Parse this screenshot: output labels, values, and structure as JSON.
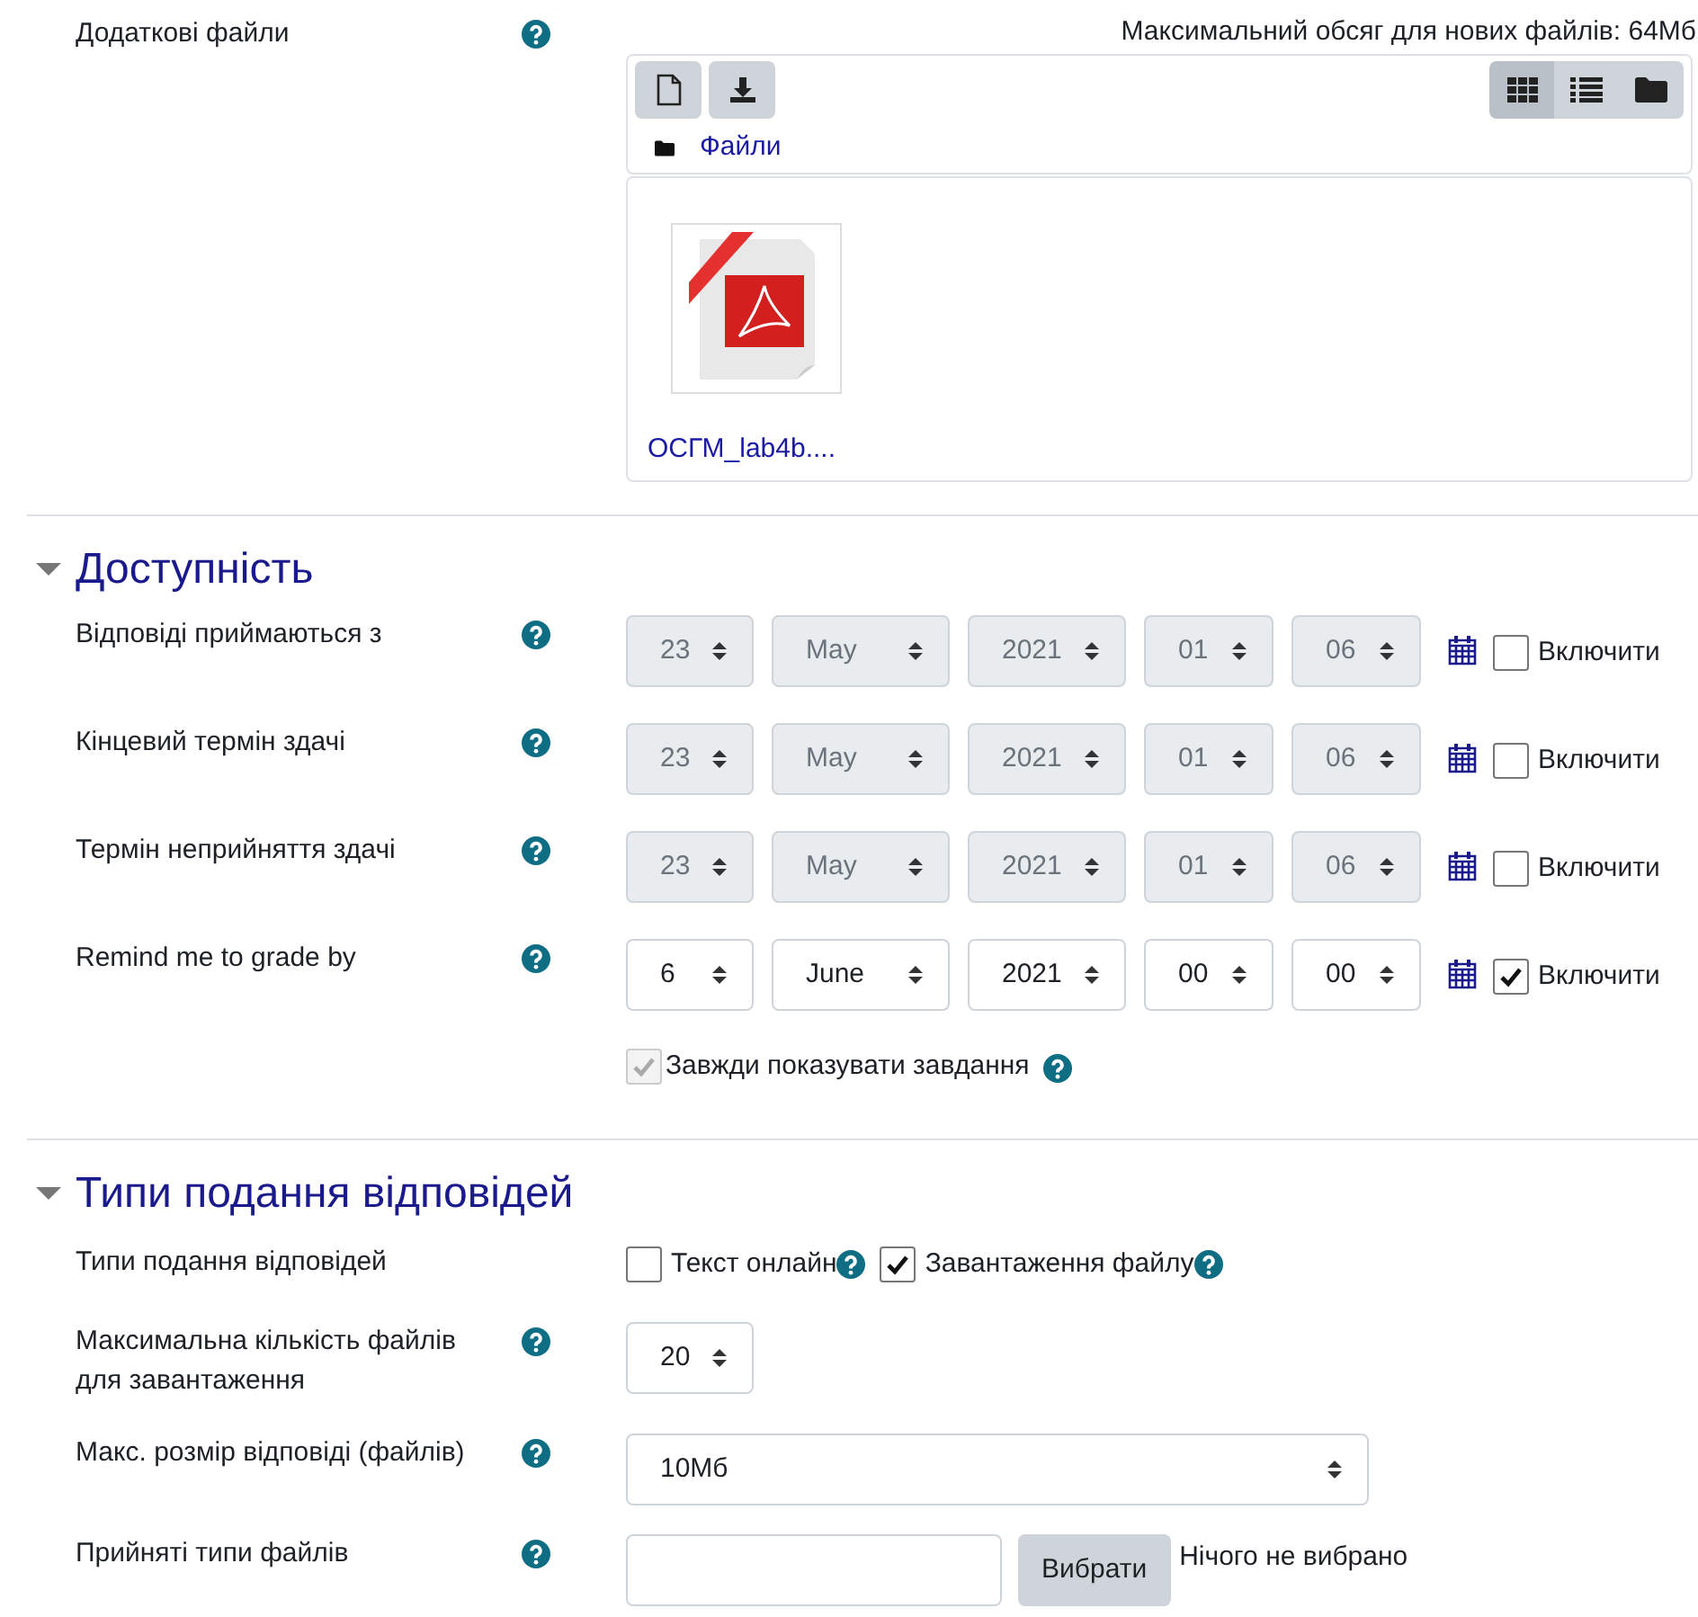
{
  "files_field": {
    "label": "Додаткові файли",
    "max_size": "Максимальний обсяг для нових файлів: 64Мб",
    "breadcrumb": "Файли",
    "view_modes": [
      {
        "kind": "icons",
        "selected": true
      },
      {
        "kind": "list",
        "selected": false
      },
      {
        "kind": "tree",
        "selected": false
      }
    ],
    "files": [
      {
        "name": "ОСГМ_lab4b...."
      }
    ]
  },
  "sections": [
    {
      "title": "Доступність",
      "expanded": true,
      "rows": [
        {
          "kind": "date",
          "label": "Відповіді приймаються з",
          "day": "23",
          "month": "May",
          "year": "2021",
          "hour": "01",
          "minute": "06",
          "enable_label": "Включити",
          "checked": false
        },
        {
          "kind": "date",
          "label": "Кінцевий термін здачі",
          "day": "23",
          "month": "May",
          "year": "2021",
          "hour": "01",
          "minute": "06",
          "enable_label": "Включити",
          "checked": false
        },
        {
          "kind": "date",
          "label": "Термін неприйняття здачі",
          "day": "23",
          "month": "May",
          "year": "2021",
          "hour": "01",
          "minute": "06",
          "enable_label": "Включити",
          "checked": false
        },
        {
          "kind": "date",
          "label": "Remind me to grade by",
          "day": "6",
          "month": "June",
          "year": "2021",
          "hour": "00",
          "minute": "00",
          "enable_label": "Включити",
          "checked": true
        },
        {
          "kind": "checkbox",
          "text": "Завжди показувати завдання",
          "checked": true,
          "disabled": true
        }
      ]
    },
    {
      "title": "Типи подання відповідей",
      "expanded": true,
      "rows": [
        {
          "kind": "checkgroup",
          "label": "Типи подання відповідей",
          "options": [
            {
              "text": "Текст онлайн",
              "checked": false
            },
            {
              "text": "Завантаження файлу",
              "checked": true
            }
          ]
        },
        {
          "kind": "select",
          "label": "Максимальна кількість файлів для завантаження",
          "value": "20",
          "wide": false
        },
        {
          "kind": "select",
          "label": "Макс. розмір відповіді (файлів)",
          "value": "10Мб",
          "wide": true
        },
        {
          "kind": "filetypes",
          "label": "Прийняті типи файлів",
          "button": "Вибрати",
          "status": "Нічого не вибрано"
        }
      ]
    }
  ]
}
